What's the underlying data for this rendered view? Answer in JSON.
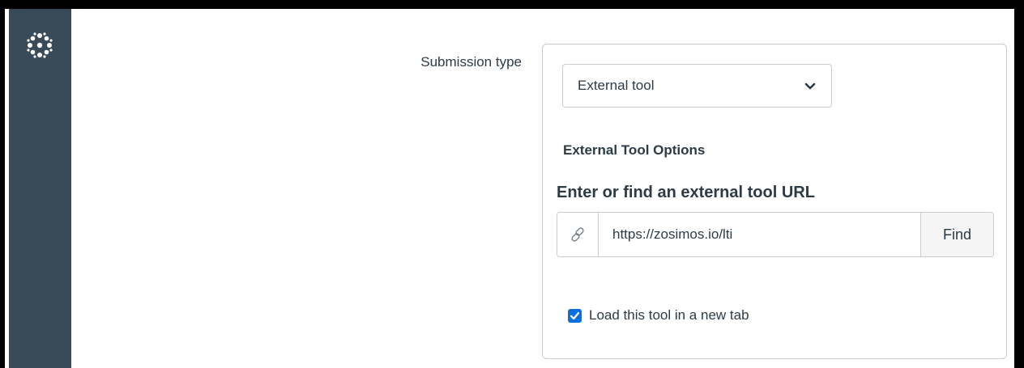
{
  "sidebar": {
    "logo_icon": "canvas-logo-icon",
    "background": "#394b58"
  },
  "form": {
    "submission_type_label": "Submission type",
    "submission_type_value": "External tool",
    "external_tool_options_title": "External Tool Options",
    "url_section_title": "Enter or find an external tool URL",
    "url_icon": "link-icon",
    "url_value": "https://zosimos.io/lti",
    "find_button_label": "Find",
    "new_tab_checkbox_checked": true,
    "new_tab_checkbox_label": "Load this tool in a new tab"
  },
  "colors": {
    "accent": "#0770dd",
    "text": "#2d3b45",
    "border": "#c7cdd1"
  }
}
